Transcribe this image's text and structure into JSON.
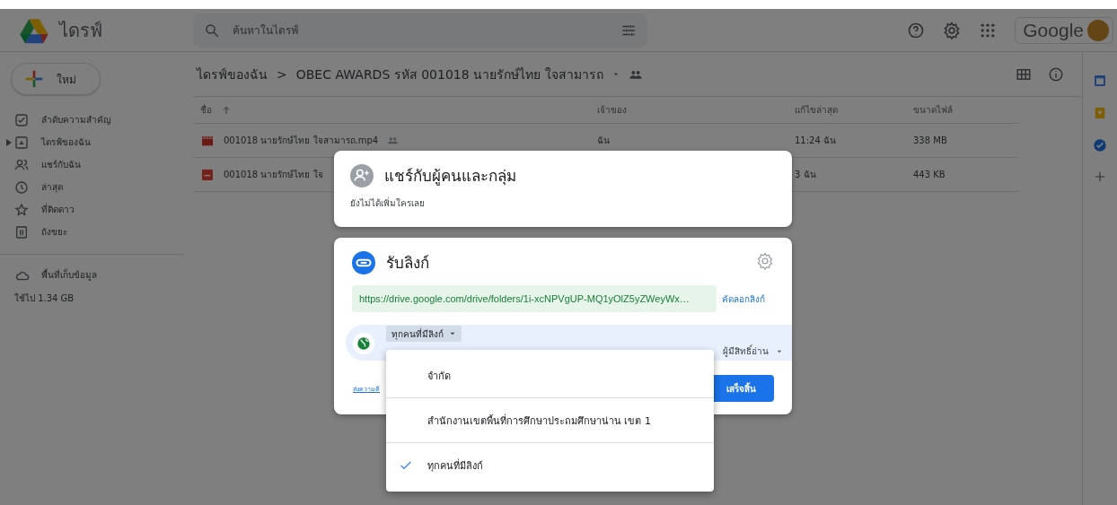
{
  "header": {
    "app_name": "ไดรฟ์",
    "search": {
      "placeholder": "ค้นหาในไดรฟ์"
    },
    "account_label": "Google"
  },
  "sidebar": {
    "new_button": "ใหม่",
    "items": [
      {
        "kind": "priority",
        "label": "ลำดับความสำคัญ",
        "expandable": false
      },
      {
        "kind": "drive",
        "label": "ไดรฟ์ของฉัน",
        "expandable": true
      },
      {
        "kind": "shared",
        "label": "แชร์กับฉัน",
        "expandable": false
      },
      {
        "kind": "recent",
        "label": "ล่าสุด",
        "expandable": false
      },
      {
        "kind": "starred",
        "label": "ที่ติดดาว",
        "expandable": false
      },
      {
        "kind": "trash",
        "label": "ถังขยะ",
        "expandable": false
      }
    ],
    "storage": {
      "label": "พื้นที่เก็บข้อมูล",
      "usage": "ใช้ไป 1.34 GB"
    }
  },
  "breadcrumb": {
    "root": "ไดรฟ์ของฉัน",
    "separator": ">",
    "folder": "OBEC AWARDS รหัส 001018 นายรักษ์ไทย ใจสามารถ"
  },
  "table": {
    "columns": [
      "ชื่อ",
      "เจ้าของ",
      "แก้ไขล่าสุด",
      "ขนาดไฟล์"
    ],
    "rows": [
      {
        "kind": "video",
        "name": "001018 นายรักษ์ไทย ใจสามารถ.mp4",
        "shared": true,
        "owner": "ฉัน",
        "modified": "11:24 ฉัน",
        "size": "338 MB"
      },
      {
        "kind": "pdf",
        "name": "001018 นายรักษ์ไทย ใจ",
        "shared": false,
        "modified": "3 ฉัน",
        "size": "443 KB"
      }
    ]
  },
  "share_dialog": {
    "people": {
      "title": "แชร์กับผู้คนและกลุ่ม",
      "subtitle": "ยังไม่ได้เพิ่มใครเลย"
    },
    "link": {
      "title": "รับลิงก์",
      "url": "https://drive.google.com/drive/folders/1i-xcNPVgUP-MQ1yOlZ5yZWeyWx…",
      "copy_label": "คัดลอกลิงก์",
      "access": "ทุกคนที่มีลิงก์",
      "role": "ผู้มีสิทธิ์อ่าน",
      "feedback_link": "ส่งความคิ",
      "done_button": "เสร็จสิ้น"
    },
    "access_menu": [
      {
        "label": "จำกัด",
        "selected": false
      },
      {
        "label": "สำนักงานเขตพื้นที่การศึกษาประถมศึกษาน่าน เขต 1",
        "selected": false
      },
      {
        "label": "ทุกคนที่มีลิงก์",
        "selected": true
      }
    ]
  }
}
